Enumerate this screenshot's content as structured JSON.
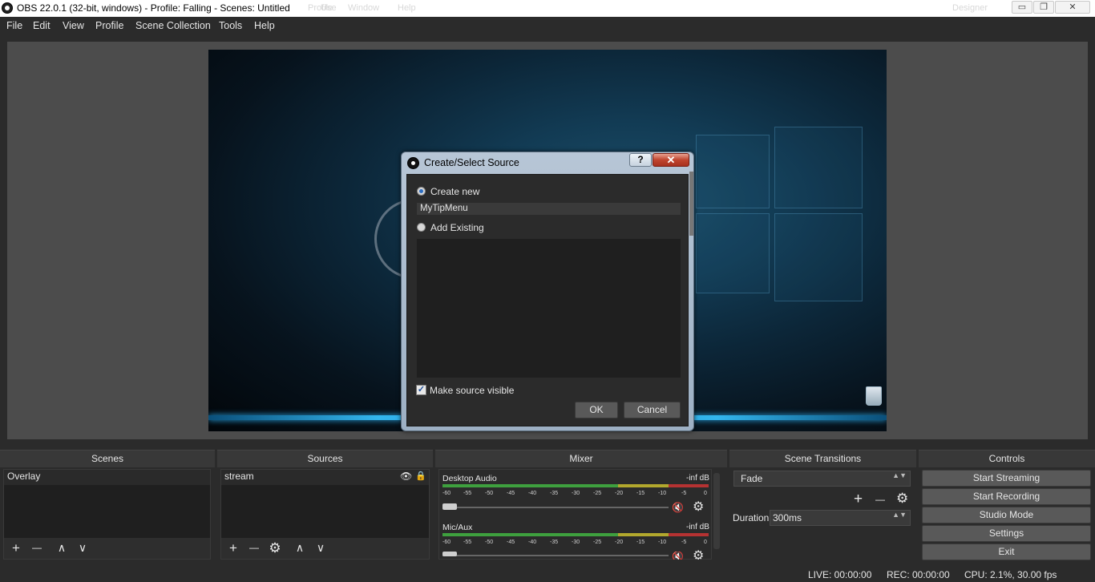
{
  "window": {
    "title": "OBS 22.0.1 (32-bit, windows) - Profile: Falling - Scenes: Untitled",
    "background_text": [
      "Profile",
      "Use",
      "Window",
      "Help",
      "Designer"
    ],
    "controls": {
      "minimize": "▭",
      "restore": "❐",
      "close": "✕"
    }
  },
  "menu": [
    "File",
    "Edit",
    "View",
    "Profile",
    "Scene Collection",
    "Tools",
    "Help"
  ],
  "dialog": {
    "title": "Create/Select Source",
    "help_label": "?",
    "close_label": "✕",
    "create_new_label": "Create new",
    "create_new_selected": true,
    "name_value": "MyTipMenu",
    "add_existing_label": "Add Existing",
    "add_existing_selected": false,
    "visible_label": "Make source visible",
    "visible_checked": true,
    "check_mark": "✓",
    "ok_label": "OK",
    "cancel_label": "Cancel"
  },
  "docks": {
    "scenes": {
      "title": "Scenes",
      "items": [
        "Overlay"
      ]
    },
    "sources": {
      "title": "Sources",
      "items": [
        "stream"
      ],
      "eye_icon": "👁",
      "lock_icon": "🔒"
    },
    "mixer": {
      "title": "Mixer",
      "channels": [
        {
          "name": "Desktop Audio",
          "level": "-inf dB"
        },
        {
          "name": "Mic/Aux",
          "level": "-inf dB"
        }
      ],
      "scale": [
        "-60",
        "-55",
        "-50",
        "-45",
        "-40",
        "-35",
        "-30",
        "-25",
        "-20",
        "-15",
        "-10",
        "-5",
        "0"
      ],
      "mute_icon": "🔇",
      "gear_icon": "⚙"
    },
    "transitions": {
      "title": "Scene Transitions",
      "selected": "Fade",
      "duration_label": "Duration",
      "duration_value": "300ms",
      "updown_arrows": "▲▼"
    },
    "controls": {
      "title": "Controls",
      "buttons": [
        "Start Streaming",
        "Start Recording",
        "Studio Mode",
        "Settings",
        "Exit"
      ]
    },
    "toolbar_icons": {
      "add": "+",
      "remove": "—",
      "up": "∧",
      "down": "∨",
      "gear": "⚙"
    }
  },
  "status": {
    "live": "LIVE: 00:00:00",
    "rec": "REC: 00:00:00",
    "cpu": "CPU: 2.1%, 30.00 fps"
  }
}
